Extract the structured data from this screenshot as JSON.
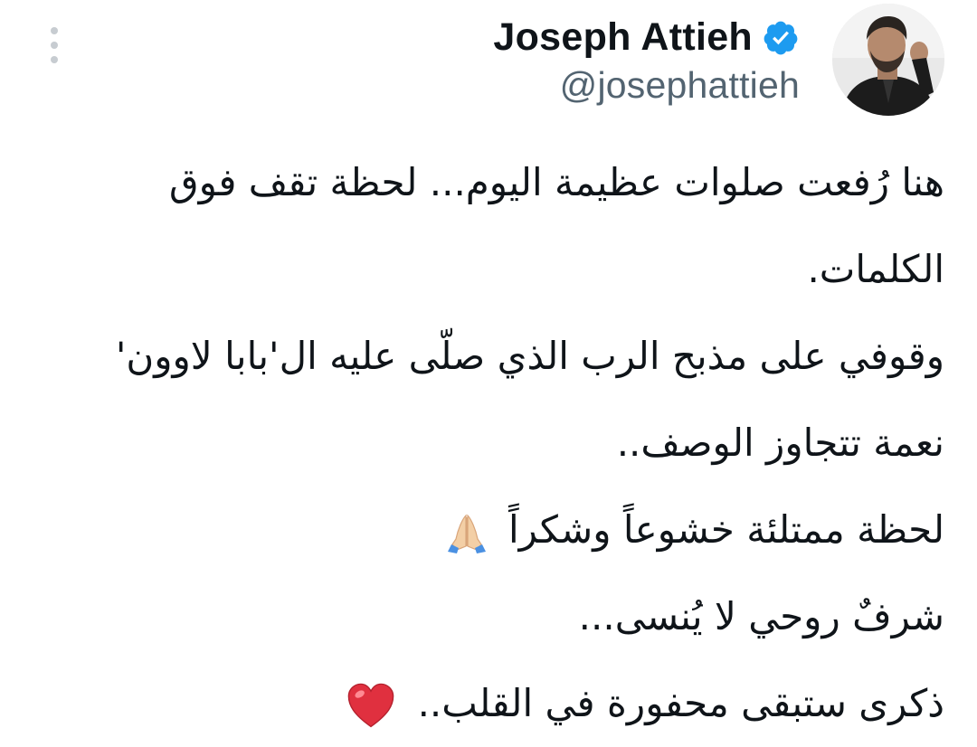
{
  "tweet": {
    "author": {
      "display_name": "Joseph Attieh",
      "handle": "@josephattieh",
      "verified": true,
      "verified_color": "#1d9bf0"
    },
    "lines": [
      "هنا رُفعت صلوات عظيمة اليوم... لحظة تقف فوق",
      "الكلمات.",
      "وقوفي على مذبح الرب الذي صلّى عليه ال'بابا لاوون'",
      "نعمة تتجاوز الوصف..",
      "لحظة ممتلئة خشوعاً وشكراً",
      "شرفٌ روحي لا يُنسى...",
      "ذكرى ستبقى محفورة في القلب.."
    ],
    "emojis": {
      "prayer": "folded-hands-icon",
      "heart": "red-heart-icon"
    }
  },
  "colors": {
    "text": "#0f1419",
    "muted": "#536471",
    "menu_dots": "#c7ccd1",
    "heart": "#e0303f",
    "verified": "#1d9bf0"
  }
}
